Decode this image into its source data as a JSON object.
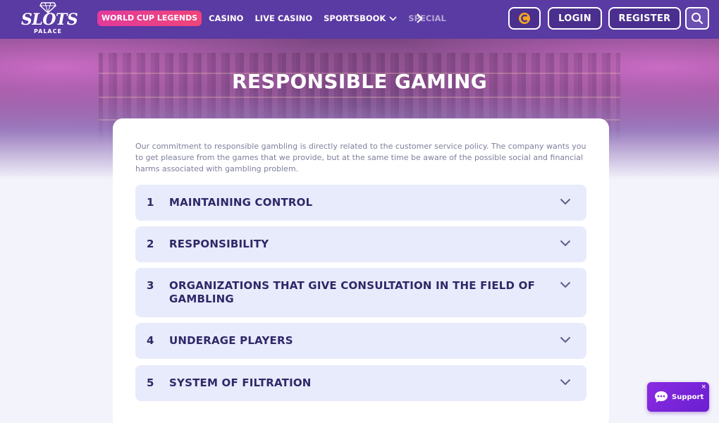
{
  "logo": {
    "brand": "SLOTS",
    "sub": "PALACE"
  },
  "nav": {
    "promo_pill": "WORLD CUP LEGENDS",
    "links": [
      "CASINO",
      "LIVE CASINO",
      "SPORTSBOOK",
      "SPECIAL"
    ]
  },
  "header": {
    "login": "LOGIN",
    "register": "REGISTER"
  },
  "hero": {
    "title": "RESPONSIBLE GAMING"
  },
  "intro": "Our commitment to responsible gambling is directly related to the customer service policy. The company wants you to get pleasure from the games that we provide, but at the same time be aware of the possible social and financial harms associated with gambling problem.",
  "accordion": [
    {
      "num": "1",
      "title": "MAINTAINING CONTROL"
    },
    {
      "num": "2",
      "title": "RESPONSIBILITY"
    },
    {
      "num": "3",
      "title": "ORGANIZATIONS THAT GIVE CONSULTATION IN THE FIELD OF GAMBLING"
    },
    {
      "num": "4",
      "title": "UNDERAGE PLAYERS"
    },
    {
      "num": "5",
      "title": "SYSTEM OF FILTRATION"
    }
  ],
  "support": {
    "label": "Support",
    "close": "×"
  },
  "colors": {
    "header": "#5a3aa3",
    "accent_pink": "#e23b9b",
    "accordion_bg": "#e8ebfb",
    "accordion_text": "#2f2868"
  }
}
